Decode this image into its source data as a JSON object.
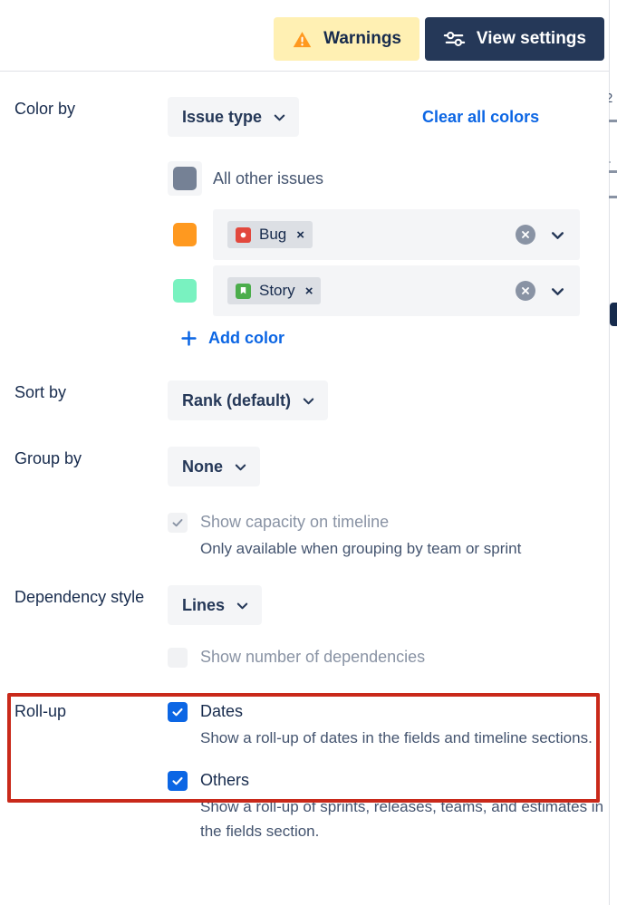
{
  "topbar": {
    "warnings_label": "Warnings",
    "warnings_icon": "warning-triangle-icon",
    "view_settings_label": "View settings",
    "view_settings_icon": "sliders-icon"
  },
  "color_by": {
    "label": "Color by",
    "select_value": "Issue type",
    "clear_all_label": "Clear all colors",
    "add_color_label": "Add color",
    "rows": [
      {
        "swatch_color": "#758195",
        "type": "static",
        "text": "All other issues"
      },
      {
        "swatch_color": "#FF991F",
        "type": "chip",
        "chip_label": "Bug",
        "chip_icon": "bug-icon",
        "chip_icon_color": "#E2483D",
        "remove_label": "×"
      },
      {
        "swatch_color": "#79F2C0",
        "type": "chip",
        "chip_label": "Story",
        "chip_icon": "story-bookmark-icon",
        "chip_icon_color": "#4BAD4B",
        "remove_label": "×"
      }
    ]
  },
  "sort_by": {
    "label": "Sort by",
    "select_value": "Rank (default)"
  },
  "group_by": {
    "label": "Group by",
    "select_value": "None",
    "capacity_checkbox_label": "Show capacity on timeline",
    "capacity_checkbox_checked": true,
    "capacity_checkbox_disabled": true,
    "capacity_description": "Only available when grouping by team or sprint"
  },
  "dependency_style": {
    "label": "Dependency style",
    "select_value": "Lines",
    "deps_checkbox_label": "Show number of dependencies",
    "deps_checkbox_checked": false,
    "deps_checkbox_disabled": true
  },
  "rollup": {
    "label": "Roll-up",
    "items": [
      {
        "label": "Dates",
        "checked": true,
        "description": "Show a roll-up of dates in the fields and timeline sections."
      },
      {
        "label": "Others",
        "checked": true,
        "description": "Show a roll-up of sprints, releases, teams, and estimates in the fields section."
      }
    ]
  },
  "highlight": {
    "color": "#c9291a"
  },
  "background": {
    "cut_glyph": "2"
  }
}
